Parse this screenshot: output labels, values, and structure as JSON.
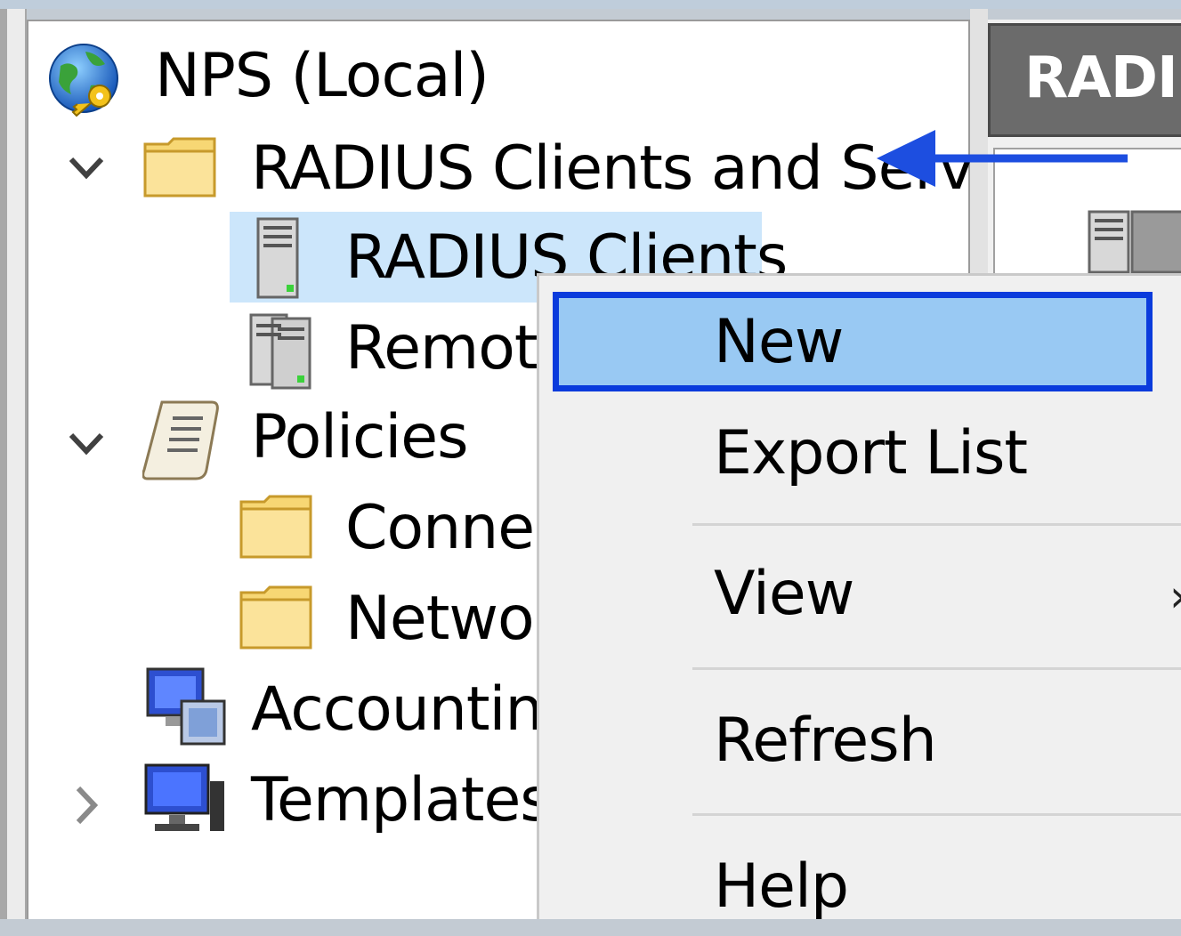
{
  "tree": {
    "root": {
      "label": "NPS (Local)",
      "icon": "globe-key-icon"
    },
    "items": [
      {
        "label": "RADIUS Clients and Servers",
        "icon": "folder-icon",
        "expanded": true
      },
      {
        "label": "RADIUS Clients",
        "icon": "server-icon",
        "selected": true
      },
      {
        "label": "Remote",
        "icon": "server-group-icon"
      },
      {
        "label": "Policies",
        "icon": "scroll-icon",
        "expanded": true
      },
      {
        "label": "Connec",
        "icon": "folder-icon"
      },
      {
        "label": "Networ",
        "icon": "folder-icon"
      },
      {
        "label": "Accounting",
        "icon": "accounting-icon"
      },
      {
        "label": "Templates",
        "icon": "computer-icon",
        "expanded": false
      }
    ]
  },
  "right_pane": {
    "header": "RADIU"
  },
  "context_menu": {
    "items": [
      {
        "label": "New",
        "highlighted": true
      },
      {
        "label": "Export List"
      },
      {
        "label": "View",
        "has_submenu": true
      },
      {
        "label": "Refresh"
      },
      {
        "label": "Help"
      }
    ]
  },
  "annotation": {
    "arrow_color": "#1d4ee0"
  },
  "colors": {
    "selection": "#cce6fb",
    "menu_highlight": "#99c9f3",
    "highlight_border": "#0a3bdc"
  }
}
